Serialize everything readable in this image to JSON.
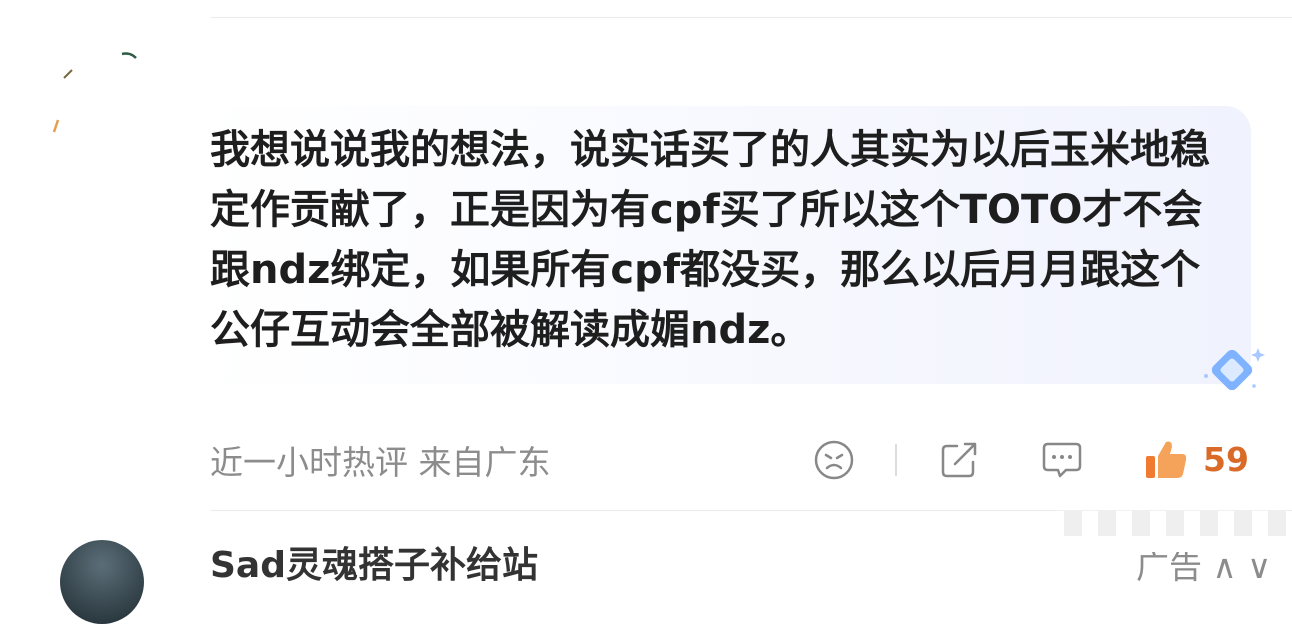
{
  "comment": {
    "text": "我想说说我的想法，说实话买了的人其实为以后玉米地稳定作贡献了，正是因为有cpf买了所以这个TOTO才不会跟ndz绑定，如果所有cpf都没买，那么以后月月跟这个公仔互动会全部被解读成媚ndz。"
  },
  "meta": {
    "time_location": "近一小时热评 来自广东",
    "like_count": "59"
  },
  "next_comment": {
    "username": "Sad灵魂搭子补给站",
    "right_text": "广告 ∧ ∨"
  },
  "icons": {
    "dislike": "sad-face-icon",
    "share": "share-icon",
    "reply": "comment-bubble-icon",
    "like": "thumbs-up-icon",
    "badge": "diamond-badge-icon"
  },
  "colors": {
    "like_accent": "#d96a28",
    "meta_gray": "#8c8c8c",
    "bubble_tint": "#f0f2fd"
  }
}
